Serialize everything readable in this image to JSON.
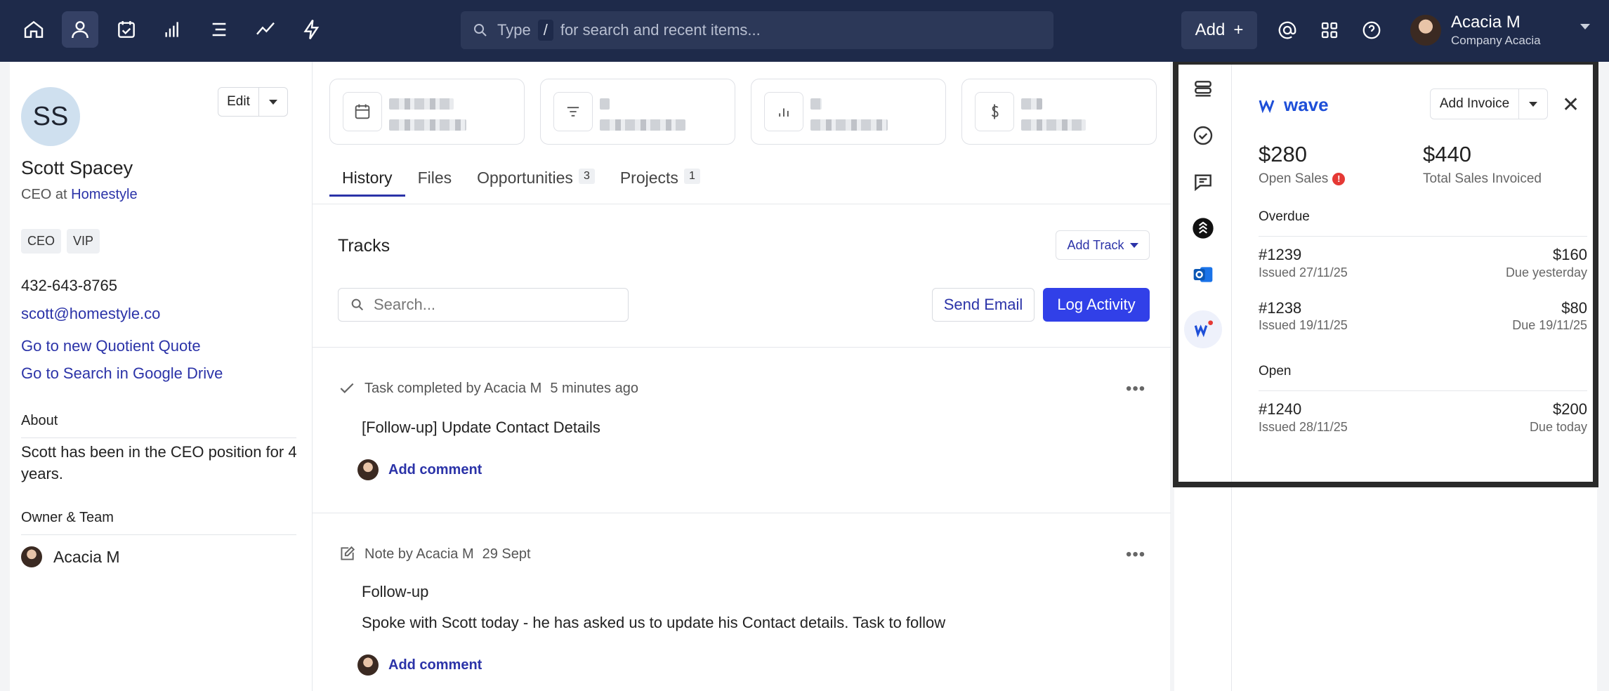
{
  "topbar": {
    "nav_icons": [
      "home-icon",
      "contacts-icon",
      "tasks-icon",
      "reports-icon",
      "lists-icon",
      "trends-icon",
      "automation-icon"
    ],
    "search": {
      "prefix": "Type",
      "shortcut": "/",
      "suffix": "for search and recent items..."
    },
    "add_label": "Add",
    "util_icons": [
      "mention-icon",
      "apps-icon",
      "help-icon"
    ],
    "user": {
      "name": "Acacia M",
      "company": "Company Acacia"
    }
  },
  "contact": {
    "initials": "SS",
    "edit_label": "Edit",
    "name": "Scott Spacey",
    "role_prefix": "CEO at",
    "company": "Homestyle",
    "tags": [
      "CEO",
      "VIP"
    ],
    "phone": "432-643-8765",
    "email": "scott@homestyle.co",
    "links": [
      "Go to new Quotient Quote",
      "Go to Search in Google Drive"
    ],
    "about_heading": "About",
    "about_text": "Scott has been in the CEO position for 4 years.",
    "owner_heading": "Owner & Team",
    "owner_name": "Acacia M"
  },
  "main": {
    "tabs": [
      {
        "label": "History",
        "badge": ""
      },
      {
        "label": "Files",
        "badge": ""
      },
      {
        "label": "Opportunities",
        "badge": "3"
      },
      {
        "label": "Projects",
        "badge": "1"
      }
    ],
    "tracks_title": "Tracks",
    "add_track_label": "Add Track",
    "search_placeholder": "Search...",
    "send_email_label": "Send Email",
    "log_activity_label": "Log Activity",
    "activities": [
      {
        "type": "Task completed by Acacia M",
        "time": "5 minutes ago",
        "title": "[Follow-up] Update Contact Details",
        "body": "",
        "comment_label": "Add comment"
      },
      {
        "type": "Note by Acacia M",
        "time": "29 Sept",
        "title": "Follow-up",
        "body": "Spoke with Scott today - he has asked us to update his Contact details. Task to follow",
        "comment_label": "Add comment"
      }
    ]
  },
  "wave": {
    "logo_text": "wave",
    "add_invoice_label": "Add Invoice",
    "open_sales_amount": "$280",
    "open_sales_label": "Open Sales",
    "total_amount": "$440",
    "total_label": "Total Sales Invoiced",
    "overdue_heading": "Overdue",
    "open_heading": "Open",
    "overdue": [
      {
        "id": "#1239",
        "issued": "Issued 27/11/25",
        "amount": "$160",
        "due": "Due yesterday"
      },
      {
        "id": "#1238",
        "issued": "Issued 19/11/25",
        "amount": "$80",
        "due": "Due 19/11/25"
      }
    ],
    "open": [
      {
        "id": "#1240",
        "issued": "Issued 28/11/25",
        "amount": "$200",
        "due": "Due today"
      }
    ]
  },
  "colors": {
    "topbar": "#1e2a4a",
    "accent": "#3140e8",
    "link": "#2b33a8",
    "alert": "#e53935",
    "wave_brand": "#1e4fd8"
  }
}
